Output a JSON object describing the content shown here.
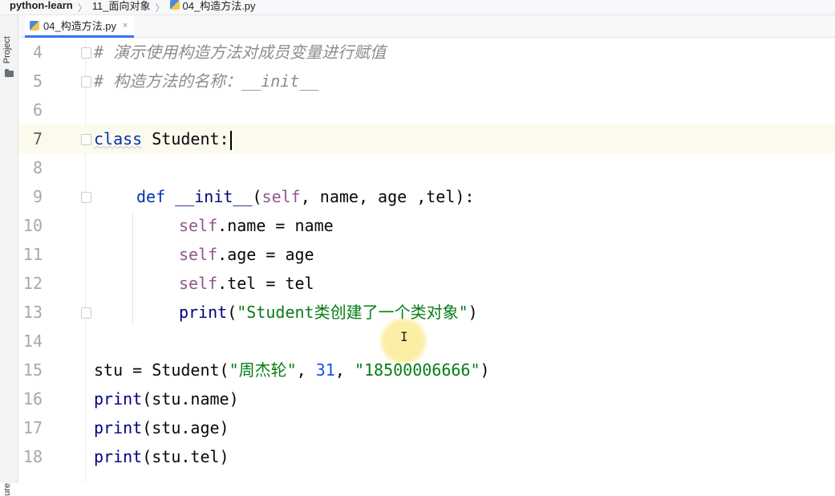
{
  "breadcrumb": {
    "project": "python-learn",
    "folder": "11_面向对象",
    "file": "04_构造方法.py"
  },
  "toolstrip": {
    "project_label": "Project",
    "structure_label": "ure"
  },
  "tab": {
    "label": "04_构造方法.py",
    "close": "×"
  },
  "code": {
    "lines": [
      {
        "num": "4",
        "comment": "# 演示使用构造方法对成员变量进行赋值"
      },
      {
        "num": "5",
        "comment": "# 构造方法的名称：__init__"
      },
      {
        "num": "6"
      },
      {
        "num": "7",
        "kw": "class",
        "name": " Student:"
      },
      {
        "num": "8"
      },
      {
        "num": "9",
        "kw": "def",
        "fn": " __init__",
        "p1": "(",
        "self": "self",
        "rest": ", name, age ,tel):"
      },
      {
        "num": "10",
        "self": "self",
        "rest": ".name = name"
      },
      {
        "num": "11",
        "self": "self",
        "rest": ".age = age"
      },
      {
        "num": "12",
        "self": "self",
        "rest": ".tel = tel"
      },
      {
        "num": "13",
        "fn": "print",
        "p1": "(",
        "str": "\"Student类创建了一个类对象\"",
        "p2": ")"
      },
      {
        "num": "14"
      },
      {
        "num": "15",
        "a": "stu = Student(",
        "s1": "\"周杰轮\"",
        "c1": ", ",
        "n1": "31",
        "c2": ", ",
        "s2": "\"18500006666\"",
        "p2": ")"
      },
      {
        "num": "16",
        "fn": "print",
        "rest": "(stu.name)"
      },
      {
        "num": "17",
        "fn": "print",
        "rest": "(stu.age)"
      },
      {
        "num": "18",
        "fn": "print",
        "rest": "(stu.tel)"
      }
    ]
  },
  "colors": {
    "keyword": "#0033b3",
    "self": "#94558d",
    "string": "#067d17",
    "number": "#1750eb",
    "comment": "#8c8c8c",
    "current_line": "#fcfaed",
    "tab_underline": "#3574f0"
  },
  "icons": {
    "python_file": "python-file-icon",
    "folder": "folder-icon",
    "close": "close-icon"
  }
}
